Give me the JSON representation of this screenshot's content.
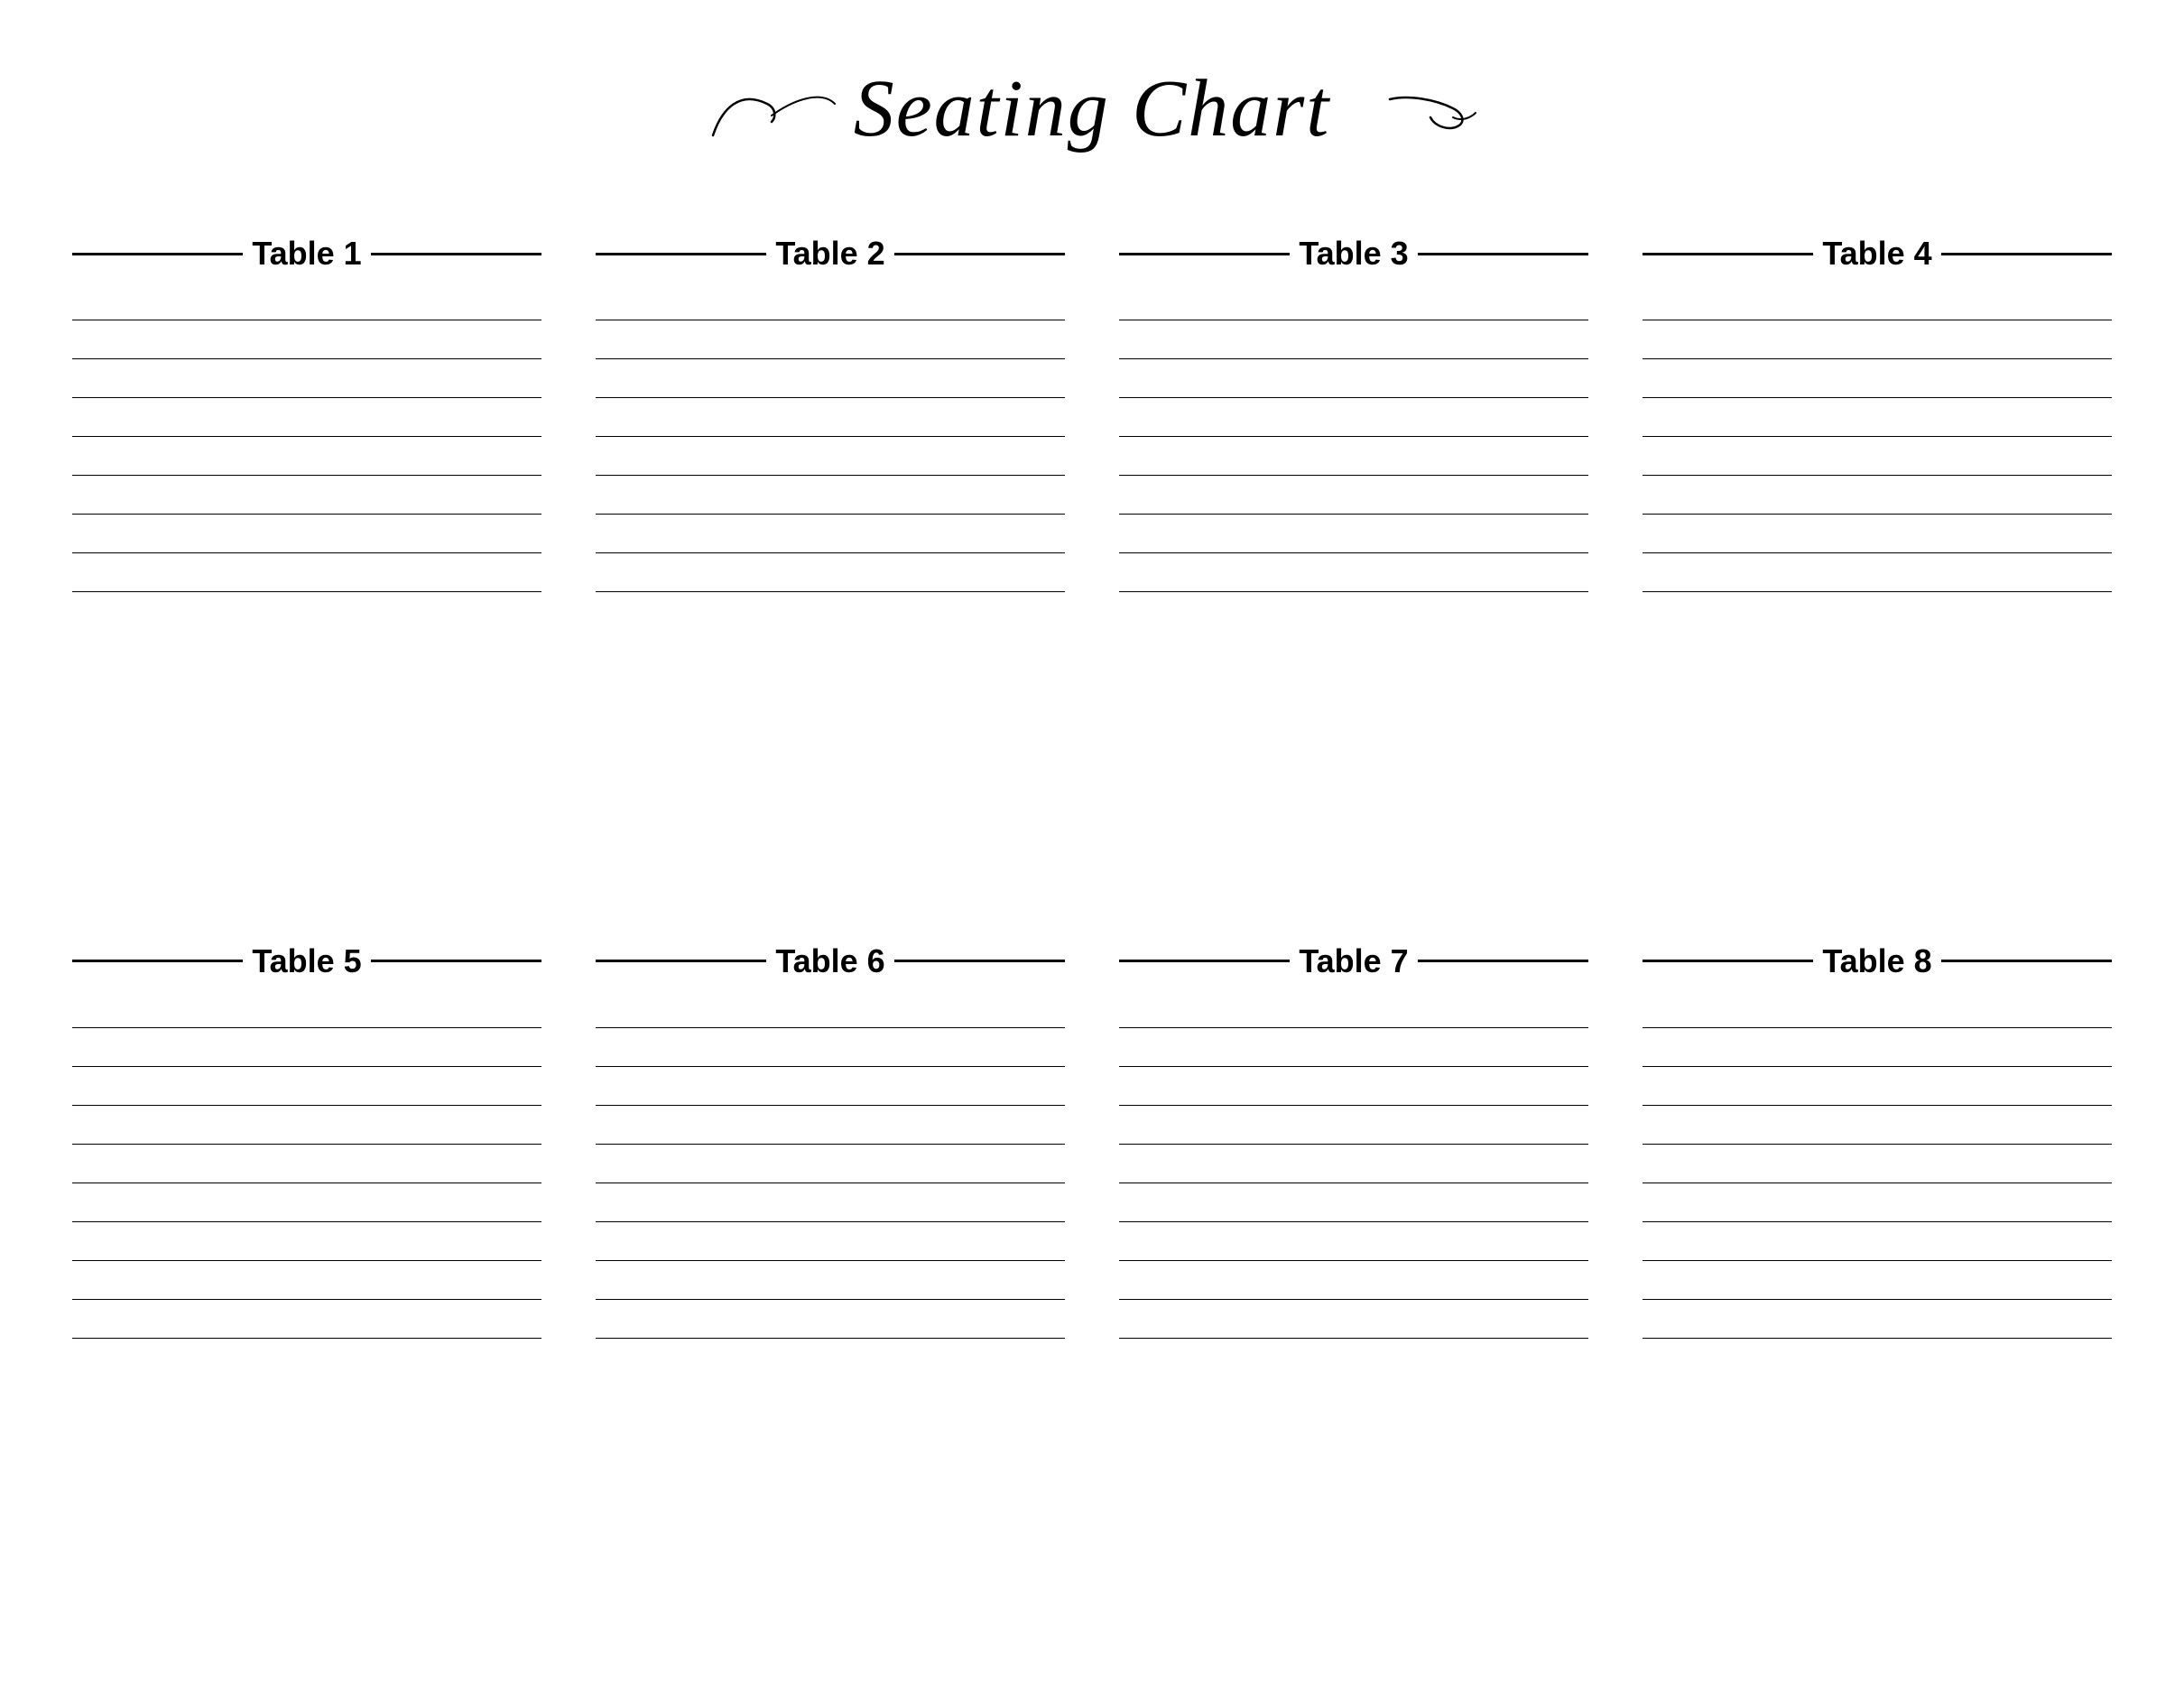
{
  "title": "Seating Chart",
  "tables": [
    {
      "id": 1,
      "label": "Table 1",
      "seats": 8
    },
    {
      "id": 2,
      "label": "Table 2",
      "seats": 8
    },
    {
      "id": 3,
      "label": "Table 3",
      "seats": 8
    },
    {
      "id": 4,
      "label": "Table 4",
      "seats": 8
    },
    {
      "id": 5,
      "label": "Table 5",
      "seats": 9
    },
    {
      "id": 6,
      "label": "Table 6",
      "seats": 9
    },
    {
      "id": 7,
      "label": "Table 7",
      "seats": 9
    },
    {
      "id": 8,
      "label": "Table 8",
      "seats": 9
    }
  ]
}
